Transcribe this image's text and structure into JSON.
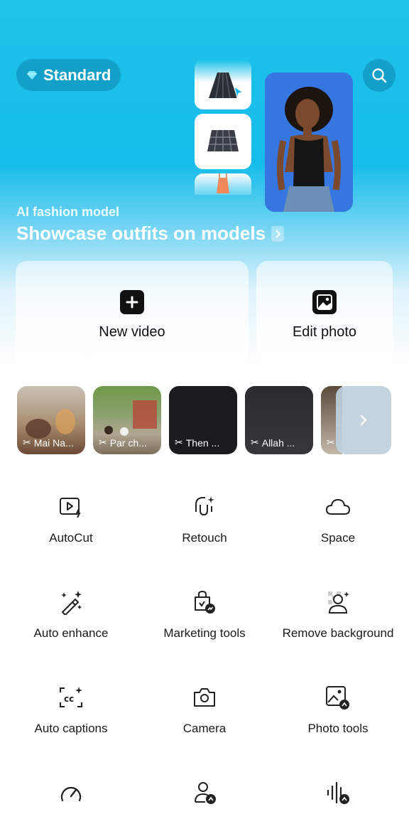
{
  "header": {
    "plan_label": "Standard"
  },
  "promo": {
    "subtitle": "AI fashion model",
    "title": "Showcase outfits on models"
  },
  "actions": [
    {
      "label": "New video",
      "icon": "plus-icon"
    },
    {
      "label": "Edit photo",
      "icon": "photo-icon"
    }
  ],
  "recent_projects": [
    {
      "label": "Mai Na..."
    },
    {
      "label": "Par ch..."
    },
    {
      "label": "Then ..."
    },
    {
      "label": "Allah ..."
    },
    {
      "label": ""
    }
  ],
  "tools": [
    {
      "label": "AutoCut",
      "icon": "autocut-icon"
    },
    {
      "label": "Retouch",
      "icon": "retouch-icon"
    },
    {
      "label": "Space",
      "icon": "cloud-icon"
    },
    {
      "label": "Auto enhance",
      "icon": "magic-wand-icon"
    },
    {
      "label": "Marketing tools",
      "icon": "shopping-bag-icon"
    },
    {
      "label": "Remove background",
      "icon": "remove-background-icon"
    },
    {
      "label": "Auto captions",
      "icon": "captions-icon"
    },
    {
      "label": "Camera",
      "icon": "camera-icon"
    },
    {
      "label": "Photo tools",
      "icon": "photo-tools-icon"
    },
    {
      "label": "",
      "icon": "speedometer-icon"
    },
    {
      "label": "",
      "icon": "person-icon"
    },
    {
      "label": "",
      "icon": "audio-wave-icon"
    }
  ],
  "colors": {
    "accent": "#16bdea",
    "dark": "#111111"
  }
}
